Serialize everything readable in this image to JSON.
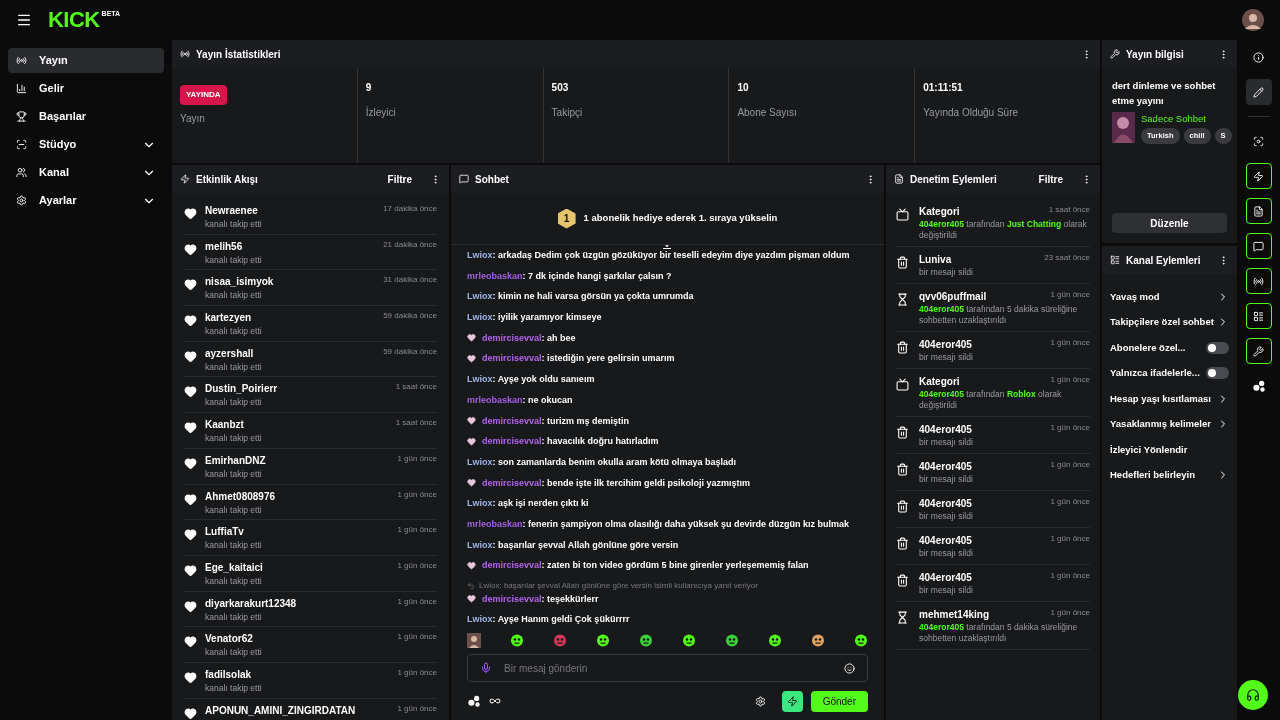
{
  "header": {
    "logo": "KICK",
    "logo_badge": "BETA"
  },
  "sidebar": {
    "items": [
      {
        "kind": "stream",
        "label": "Yayın",
        "selected": true,
        "expandable": false
      },
      {
        "kind": "revenue",
        "label": "Gelir",
        "selected": false,
        "expandable": false
      },
      {
        "kind": "trophy",
        "label": "Başarılar",
        "selected": false,
        "expandable": false
      },
      {
        "kind": "studio",
        "label": "Stüdyo",
        "selected": false,
        "expandable": true
      },
      {
        "kind": "channel",
        "label": "Kanal",
        "selected": false,
        "expandable": true
      },
      {
        "kind": "settings",
        "label": "Ayarlar",
        "selected": false,
        "expandable": true
      }
    ]
  },
  "stats": {
    "title": "Yayın İstatistikleri",
    "cells": [
      {
        "kind": "badge",
        "value": "YAYINDA",
        "label": "Yayın"
      },
      {
        "kind": "number",
        "value": "9",
        "label": "İzleyici"
      },
      {
        "kind": "number",
        "value": "503",
        "label": "Takipçi"
      },
      {
        "kind": "number",
        "value": "10",
        "label": "Abone Sayısı"
      },
      {
        "kind": "number",
        "value": "01:11:51",
        "label": "Yayında Olduğu Süre"
      }
    ]
  },
  "activity": {
    "title": "Etkinlik Akışı",
    "filter": "Filtre",
    "items": [
      {
        "user": "Newraenee",
        "action": "kanalı takip etti",
        "time": "17 dakika önce"
      },
      {
        "user": "melih56",
        "action": "kanalı takip etti",
        "time": "21 dakika önce"
      },
      {
        "user": "nisaa_isimyok",
        "action": "kanalı takip etti",
        "time": "31 dakika önce"
      },
      {
        "user": "kartezyen",
        "action": "kanalı takip etti",
        "time": "59 dakika önce"
      },
      {
        "user": "ayzershall",
        "action": "kanalı takip etti",
        "time": "59 dakika önce"
      },
      {
        "user": "Dustin_Poirierr",
        "action": "kanalı takip etti",
        "time": "1 saat önce"
      },
      {
        "user": "Kaanbzt",
        "action": "kanalı takip etti",
        "time": "1 saat önce"
      },
      {
        "user": "EmirhanDNZ",
        "action": "kanalı takip etti",
        "time": "1 gün önce"
      },
      {
        "user": "Ahmet0808976",
        "action": "kanalı takip etti",
        "time": "1 gün önce"
      },
      {
        "user": "LuffiaTv",
        "action": "kanalı takip etti",
        "time": "1 gün önce"
      },
      {
        "user": "Ege_kaitaici",
        "action": "kanalı takip etti",
        "time": "1 gün önce"
      },
      {
        "user": "diyarkarakurt12348",
        "action": "kanalı takip etti",
        "time": "1 gün önce"
      },
      {
        "user": "Venator62",
        "action": "kanalı takip etti",
        "time": "1 gün önce"
      },
      {
        "user": "fadilsolak",
        "action": "kanalı takip etti",
        "time": "1 gün önce"
      },
      {
        "user": "APONUN_AMINI_ZINGIRDATAN",
        "time": "1 gün önce"
      }
    ]
  },
  "chat": {
    "title": "Sohbet",
    "rank": "1",
    "banner": "1 abonelik hediye ederek 1. sıraya yükselin",
    "messages": [
      {
        "kind": "message",
        "user": "Lwiox",
        "color": "#9fb4e6",
        "badge": false,
        "text": ": arkadaş Dedim çok üzgün gözüküyor bir teselli edeyim diye yazdım pişman oldum"
      },
      {
        "kind": "message",
        "user": "mrleobaskan",
        "color": "#a55fe8",
        "badge": false,
        "text": ": 7 dk içinde hangi şarkılar çalsın ?"
      },
      {
        "kind": "message",
        "user": "Lwiox",
        "color": "#9fb4e6",
        "badge": false,
        "text": ": kimin ne hali varsa görsün ya çokta umrumda"
      },
      {
        "kind": "message",
        "user": "Lwiox",
        "color": "#9fb4e6",
        "badge": false,
        "text": ": iyilik yaramıyor kimseye"
      },
      {
        "kind": "message",
        "user": "demircisevval",
        "color": "#b364ee",
        "badge": true,
        "text": ": ah bee"
      },
      {
        "kind": "message",
        "user": "demircisevval",
        "color": "#b364ee",
        "badge": true,
        "text": ": istediğin yere gelirsin umarım"
      },
      {
        "kind": "message",
        "user": "Lwiox",
        "color": "#9fb4e6",
        "badge": false,
        "text": ": Ayşe yok oldu sanıeım"
      },
      {
        "kind": "message",
        "user": "mrleobaskan",
        "color": "#a55fe8",
        "badge": false,
        "text": ": ne okucan"
      },
      {
        "kind": "message",
        "user": "demircisevval",
        "color": "#b364ee",
        "badge": true,
        "text": ": turizm mş demiştin"
      },
      {
        "kind": "message",
        "user": "demircisevval",
        "color": "#b364ee",
        "badge": true,
        "text": ": havacılık doğru hatırladım"
      },
      {
        "kind": "message",
        "user": "Lwiox",
        "color": "#9fb4e6",
        "badge": false,
        "text": ": son zamanlarda benim okulla aram kötü olmaya başladı"
      },
      {
        "kind": "message",
        "user": "demircisevval",
        "color": "#b364ee",
        "badge": true,
        "text": ": bende işte ilk tercihim geldi psikoloji yazmıştım"
      },
      {
        "kind": "message",
        "user": "Lwiox",
        "color": "#9fb4e6",
        "badge": false,
        "text": ": aşk işi nerden çıktı ki"
      },
      {
        "kind": "message",
        "user": "mrleobaskan",
        "color": "#a55fe8",
        "badge": false,
        "text": ": fenerin şampiyon olma olasılığı daha yüksek şu devirde düzgün kız bulmak"
      },
      {
        "kind": "message",
        "user": "Lwiox",
        "color": "#9fb4e6",
        "badge": false,
        "text": ": başarılar şevval Allah gönlüne göre versin"
      },
      {
        "kind": "message",
        "user": "demircisevval",
        "color": "#b364ee",
        "badge": true,
        "text": ": zaten bi ton video gördüm 5 bine girenler yerleşememiş falan"
      },
      {
        "kind": "reply",
        "text": "Lwiox: başarılar şevval Allah gönlüne göre versin isimli kullanıcıya yanıt veriyor"
      },
      {
        "kind": "message",
        "user": "demircisevval",
        "color": "#b364ee",
        "badge": true,
        "text": ": teşekkürlerr"
      },
      {
        "kind": "message",
        "user": "Lwiox",
        "color": "#9fb4e6",
        "badge": false,
        "text": ": Ayşe Hanım geldi Çok şükürrrr"
      }
    ],
    "input": {
      "placeholder": "Bir mesaj gönderin"
    },
    "send": "Gönder"
  },
  "moderation": {
    "title": "Denetim Eylemleri",
    "filter": "Filtre",
    "items": [
      {
        "kind": "category",
        "title": "Kategori",
        "time": "1 saat önce",
        "parts": [
          {
            "text": "404eror405",
            "highlight": true
          },
          {
            "text": " tarafından ",
            "highlight": false
          },
          {
            "text": "Just Chatting",
            "highlight": true
          },
          {
            "text": " olarak değiştirildi",
            "highlight": false
          }
        ]
      },
      {
        "kind": "delete",
        "title": "Luniva",
        "time": "23 saat önce",
        "parts": [
          {
            "text": "bir mesajı sildi",
            "highlight": false
          }
        ]
      },
      {
        "kind": "timeout",
        "title": "qvv06puffmail",
        "time": "1 gün önce",
        "parts": [
          {
            "text": "404eror405",
            "highlight": true
          },
          {
            "text": " tarafından 5 dakika süreliğine sohbetten uzaklaştırıldı",
            "highlight": false
          }
        ]
      },
      {
        "kind": "delete",
        "title": "404eror405",
        "time": "1 gün önce",
        "parts": [
          {
            "text": "bir mesajı sildi",
            "highlight": false
          }
        ]
      },
      {
        "kind": "category",
        "title": "Kategori",
        "time": "1 gün önce",
        "parts": [
          {
            "text": "404eror405",
            "highlight": true
          },
          {
            "text": " tarafından ",
            "highlight": false
          },
          {
            "text": "Roblox",
            "highlight": true
          },
          {
            "text": " olarak değiştirildi",
            "highlight": false
          }
        ]
      },
      {
        "kind": "delete",
        "title": "404eror405",
        "time": "1 gün önce",
        "parts": [
          {
            "text": "bir mesajı sildi",
            "highlight": false
          }
        ]
      },
      {
        "kind": "delete",
        "title": "404eror405",
        "time": "1 gün önce",
        "parts": [
          {
            "text": "bir mesajı sildi",
            "highlight": false
          }
        ]
      },
      {
        "kind": "delete",
        "title": "404eror405",
        "time": "1 gün önce",
        "parts": [
          {
            "text": "bir mesajı sildi",
            "highlight": false
          }
        ]
      },
      {
        "kind": "delete",
        "title": "404eror405",
        "time": "1 gün önce",
        "parts": [
          {
            "text": "bir mesajı sildi",
            "highlight": false
          }
        ]
      },
      {
        "kind": "delete",
        "title": "404eror405",
        "time": "1 gün önce",
        "parts": [
          {
            "text": "bir mesajı sildi",
            "highlight": false
          }
        ]
      },
      {
        "kind": "timeout",
        "title": "mehmet14king",
        "time": "1 gün önce",
        "parts": [
          {
            "text": "404eror405",
            "highlight": true
          },
          {
            "text": " tarafından 5 dakika süreliğine sohbetten uzaklaştırıldı",
            "highlight": false
          }
        ]
      }
    ]
  },
  "stream_info": {
    "title": "Yayın bilgisi",
    "stream_title": "dert dinleme ve sohbet etme yayını",
    "category": "Sadece Sohbet",
    "tags": [
      "Turkish",
      "chill",
      "S"
    ],
    "edit": "Düzenle"
  },
  "channel_actions": {
    "title": "Kanal Eylemleri",
    "items": [
      {
        "kind": "link",
        "label": "Yavaş mod"
      },
      {
        "kind": "link",
        "label": "Takipçilere özel sohbet"
      },
      {
        "kind": "toggle",
        "label": "Abonelere özel...",
        "on": false
      },
      {
        "kind": "toggle",
        "label": "Yalnızca ifadelerle...",
        "on": false
      },
      {
        "kind": "link",
        "label": "Hesap yaşı kısıtlaması"
      },
      {
        "kind": "link",
        "label": "Yasaklanmış kelimeler"
      },
      {
        "kind": "plain",
        "label": "İzleyici Yönlendir"
      },
      {
        "kind": "link",
        "label": "Hedefleri belirleyin"
      }
    ]
  },
  "rail": [
    {
      "kind": "info",
      "selected": false,
      "pinned": false
    },
    {
      "kind": "pencil",
      "selected": true,
      "pinned": false
    },
    {
      "kind": "separator"
    },
    {
      "kind": "focus",
      "selected": false,
      "pinned": false
    },
    {
      "kind": "zap",
      "selected": false,
      "pinned": true
    },
    {
      "kind": "file",
      "selected": false,
      "pinned": true
    },
    {
      "kind": "message",
      "selected": false,
      "pinned": true
    },
    {
      "kind": "radio",
      "selected": false,
      "pinned": true
    },
    {
      "kind": "layout",
      "selected": false,
      "pinned": true
    },
    {
      "kind": "wrench",
      "selected": false,
      "pinned": true
    },
    {
      "kind": "dots",
      "selected": false,
      "pinned": false
    }
  ]
}
